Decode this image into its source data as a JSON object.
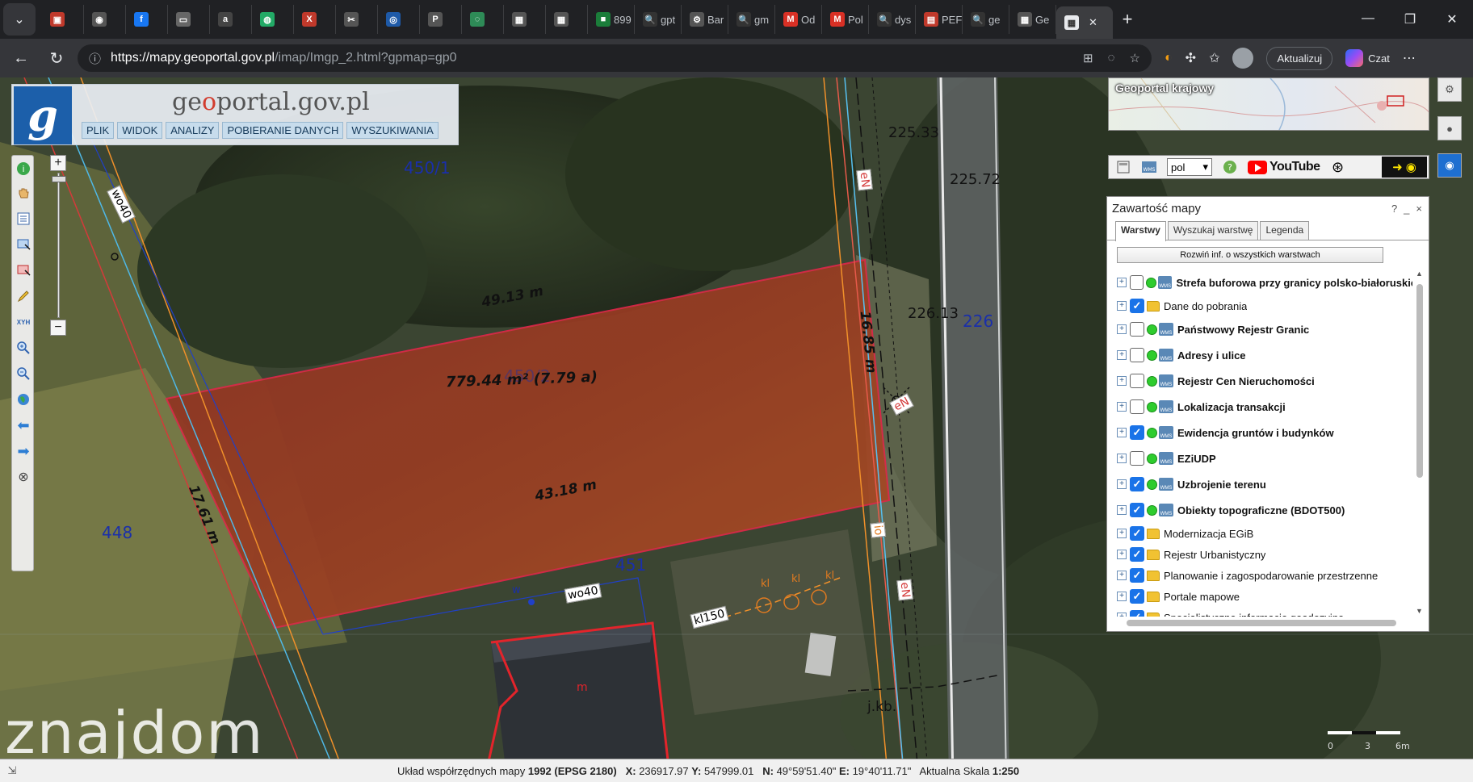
{
  "browser": {
    "tabs": [
      {
        "label": "",
        "fav": "▣",
        "color": "#c0392b"
      },
      {
        "label": "",
        "fav": "◉",
        "color": "#555"
      },
      {
        "label": "",
        "fav": "f",
        "color": "#1877f2"
      },
      {
        "label": "",
        "fav": "▭",
        "color": "#666"
      },
      {
        "label": "",
        "fav": "a",
        "color": "#444"
      },
      {
        "label": "",
        "fav": "◍",
        "color": "#2a6"
      },
      {
        "label": "",
        "fav": "X",
        "color": "#c0392b"
      },
      {
        "label": "",
        "fav": "✂",
        "color": "#555"
      },
      {
        "label": "",
        "fav": "◎",
        "color": "#1e5aa8"
      },
      {
        "label": "",
        "fav": "P",
        "color": "#555"
      },
      {
        "label": "",
        "fav": "◌",
        "color": "#2e8b57"
      },
      {
        "label": "",
        "fav": "▦",
        "color": "#555"
      },
      {
        "label": "",
        "fav": "▦",
        "color": "#555"
      },
      {
        "label": "899",
        "fav": "■",
        "color": "#1b7d3a"
      },
      {
        "label": "gpt",
        "fav": "🔍",
        "color": "#333"
      },
      {
        "label": "Bar",
        "fav": "⚙",
        "color": "#555"
      },
      {
        "label": "gm",
        "fav": "🔍",
        "color": "#333"
      },
      {
        "label": "Od",
        "fav": "M",
        "color": "#d93025"
      },
      {
        "label": "Pol",
        "fav": "M",
        "color": "#d93025"
      },
      {
        "label": "dys",
        "fav": "🔍",
        "color": "#333"
      },
      {
        "label": "PEF",
        "fav": "▤",
        "color": "#c0392b"
      },
      {
        "label": "ge",
        "fav": "🔍",
        "color": "#333"
      },
      {
        "label": "Ge",
        "fav": "▦",
        "color": "#555"
      }
    ],
    "url_host": "https://mapy.geoportal.gov.pl",
    "url_path": "/imap/Imgp_2.html?gpmap=gp0",
    "update_label": "Aktualizuj",
    "copilot_label": "Czat"
  },
  "geoportal": {
    "title_pre": "ge",
    "title_o": "o",
    "title_post": "portal.gov.pl",
    "logo_letter": "g",
    "menu": [
      "PLIK",
      "WIDOK",
      "ANALIZY",
      "POBIERANIE DANYCH",
      "WYSZUKIWANIA"
    ]
  },
  "map": {
    "parcels": {
      "p4501": "450/1",
      "p226": "226",
      "p448": "448",
      "p451": "451",
      "p4502": "450/2"
    },
    "heights": {
      "h1": "225.33",
      "h2": "225.72",
      "h3": "226.13"
    },
    "dimensions": {
      "top": "49.13 m",
      "right": "16.85 m",
      "bottom": "43.18 m",
      "left": "17.61 m"
    },
    "area": "779.44 m² (7.79 a)",
    "network_labels": {
      "wo40a": "wo40",
      "wo40b": "wo40",
      "kl150": "kl150",
      "eN1": "eN",
      "eN2": "eN",
      "eN3": "eN",
      "io": "io",
      "w": "w",
      "kl1": "kl",
      "kl2": "kl",
      "kl3": "kl",
      "jkb": "j.kb.",
      "m": "m"
    },
    "watermark": "znajdom"
  },
  "minimap": {
    "title": "Geoportal krajowy"
  },
  "iconbar": {
    "lang": "pol",
    "youtube": "YouTube"
  },
  "layers_panel": {
    "title": "Zawartość mapy",
    "help": "?",
    "minimize": "_",
    "close": "×",
    "tabs": [
      "Warstwy",
      "Wyszukaj warstwę",
      "Legenda"
    ],
    "expand_all": "Rozwiń inf. o wszystkich warstwach",
    "layers": [
      {
        "name": "Strefa buforowa przy granicy polsko-białoruskiej",
        "checked": false,
        "type": "wms",
        "bold": true
      },
      {
        "name": "Dane do pobrania",
        "checked": true,
        "type": "folder",
        "bold": false
      },
      {
        "name": "Państwowy Rejestr Granic",
        "checked": false,
        "type": "wms",
        "bold": true
      },
      {
        "name": "Adresy i ulice",
        "checked": false,
        "type": "wms",
        "bold": true
      },
      {
        "name": "Rejestr Cen Nieruchomości",
        "checked": false,
        "type": "wms",
        "bold": true
      },
      {
        "name": "Lokalizacja transakcji",
        "checked": false,
        "type": "wms",
        "bold": true
      },
      {
        "name": "Ewidencja gruntów i budynków",
        "checked": true,
        "type": "wms",
        "bold": true
      },
      {
        "name": "EZiUDP",
        "checked": false,
        "type": "wms",
        "bold": true
      },
      {
        "name": "Uzbrojenie terenu",
        "checked": true,
        "type": "wms",
        "bold": true
      },
      {
        "name": "Obiekty topograficzne (BDOT500)",
        "checked": true,
        "type": "wms",
        "bold": true
      },
      {
        "name": "Modernizacja EGiB",
        "checked": true,
        "type": "folder",
        "bold": false
      },
      {
        "name": "Rejestr Urbanistyczny",
        "checked": true,
        "type": "folder",
        "bold": false
      },
      {
        "name": "Planowanie i zagospodarowanie przestrzenne",
        "checked": true,
        "type": "folder",
        "bold": false
      },
      {
        "name": "Portale mapowe",
        "checked": true,
        "type": "folder",
        "bold": false
      },
      {
        "name": "Specjalistyczne informacje geodezyjne",
        "checked": true,
        "type": "folder",
        "bold": false
      }
    ]
  },
  "status": {
    "system_label": "Układ współrzędnych mapy",
    "system_value": "1992 (EPSG 2180)",
    "x_label": "X:",
    "x_value": "236917.97",
    "y_label": "Y:",
    "y_value": "547999.01",
    "n_label": "N:",
    "n_value": "49°59'51.40\"",
    "e_label": "E:",
    "e_value": "19°40'11.71\"",
    "scale_label": "Aktualna Skala",
    "scale_value": "1:250"
  },
  "scalebar": {
    "t0": "0",
    "t1": "3",
    "t2": "6m"
  }
}
